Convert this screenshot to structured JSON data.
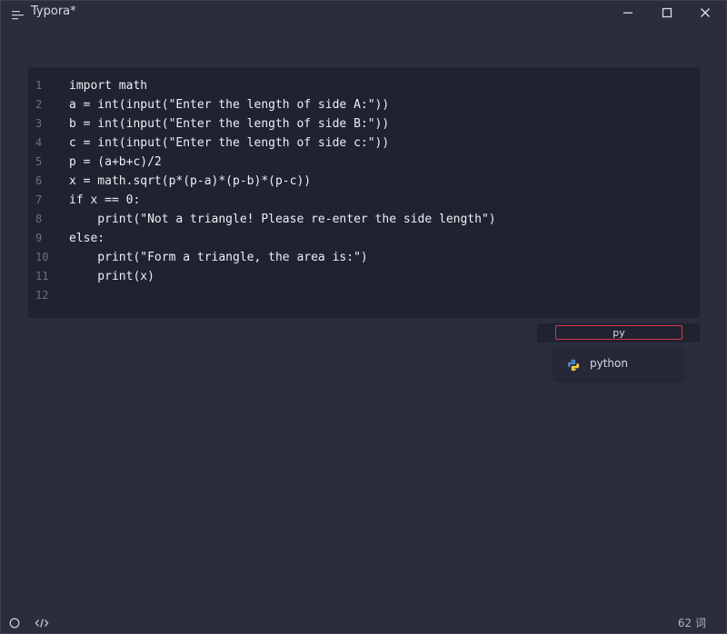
{
  "window": {
    "title": "Typora*"
  },
  "titlebar": {
    "menu_icon": "hamburger-menu-icon",
    "minimize_icon": "minimize-icon",
    "maximize_icon": "maximize-icon",
    "close_icon": "close-icon"
  },
  "code_block": {
    "lines": [
      {
        "num": "1",
        "text": "import math"
      },
      {
        "num": "2",
        "text": "a = int(input(\"Enter the length of side A:\"))"
      },
      {
        "num": "3",
        "text": "b = int(input(\"Enter the length of side B:\"))"
      },
      {
        "num": "4",
        "text": "c = int(input(\"Enter the length of side c:\"))"
      },
      {
        "num": "5",
        "text": "p = (a+b+c)/2"
      },
      {
        "num": "6",
        "text": "x = math.sqrt(p*(p-a)*(p-b)*(p-c))"
      },
      {
        "num": "7",
        "text": "if x == 0:"
      },
      {
        "num": "8",
        "text": "    print(\"Not a triangle! Please re-enter the side length\")"
      },
      {
        "num": "9",
        "text": "else:"
      },
      {
        "num": "10",
        "text": "    print(\"Form a triangle, the area is:\")"
      },
      {
        "num": "11",
        "text": "    print(x)"
      },
      {
        "num": "12",
        "text": ""
      }
    ]
  },
  "language_input": {
    "value": "py"
  },
  "language_dropdown": {
    "options": [
      {
        "label": "python",
        "icon": "python-icon"
      }
    ]
  },
  "statusbar": {
    "outline_icon": "outline-circle-icon",
    "source_icon": "source-code-icon",
    "word_count": "62 词"
  },
  "colors": {
    "background": "#2b2d3d",
    "code_background": "#202230",
    "accent_border": "#d33a46"
  }
}
